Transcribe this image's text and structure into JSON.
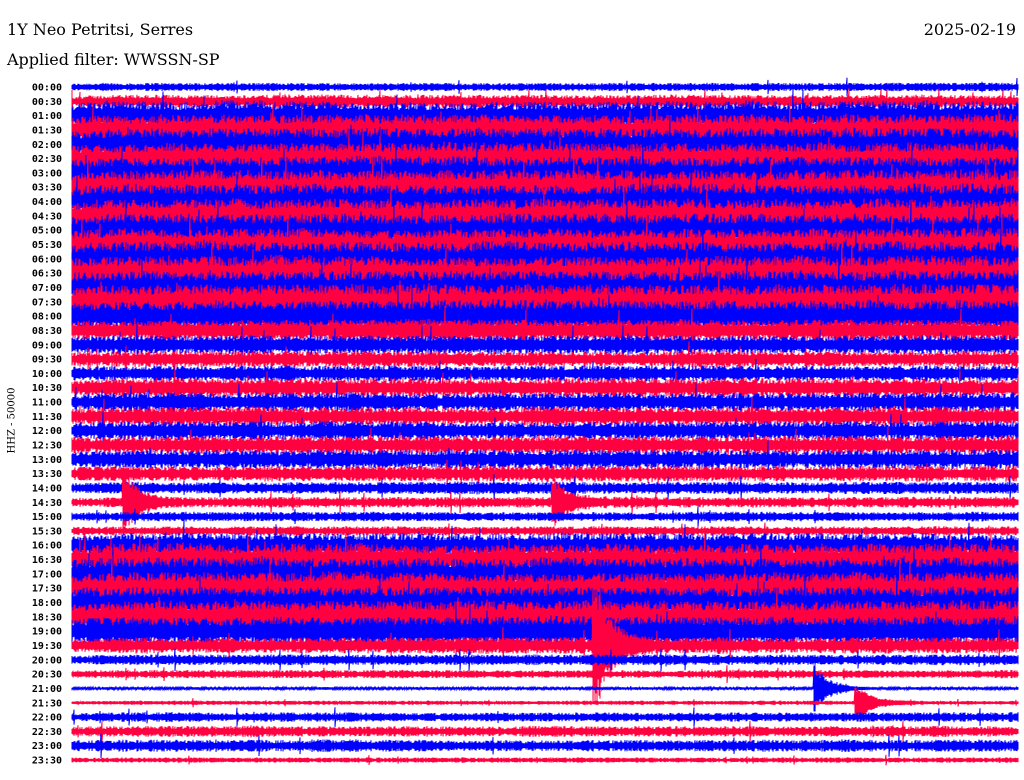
{
  "header": {
    "station": "1Y Neo Petritsi, Serres",
    "date": "2025-02-19",
    "filter": "Applied filter: WWSSN-SP"
  },
  "chart_data": {
    "type": "line",
    "title": "1Y Neo Petritsi, Serres",
    "ylabel": "HHZ - 50000",
    "xlabel": "",
    "colors": [
      "#0000ff",
      "#ff0040"
    ],
    "row_labels": [
      "00:00",
      "00:30",
      "01:00",
      "01:30",
      "02:00",
      "02:30",
      "03:00",
      "03:30",
      "04:00",
      "04:30",
      "05:00",
      "05:30",
      "06:00",
      "06:30",
      "07:00",
      "07:30",
      "08:00",
      "08:30",
      "09:00",
      "09:30",
      "10:00",
      "10:30",
      "11:00",
      "11:30",
      "12:00",
      "12:30",
      "13:00",
      "13:30",
      "14:00",
      "14:30",
      "15:00",
      "15:30",
      "16:00",
      "16:30",
      "17:00",
      "17:30",
      "18:00",
      "18:30",
      "19:00",
      "19:30",
      "20:00",
      "20:30",
      "21:00",
      "21:30",
      "22:00",
      "22:30",
      "23:00",
      "23:30"
    ],
    "relative_noise_amplitude": [
      0.3,
      0.5,
      1.1,
      1.2,
      1.2,
      1.2,
      1.2,
      1.3,
      1.3,
      1.3,
      1.2,
      1.2,
      1.3,
      1.3,
      1.3,
      1.3,
      1.2,
      0.8,
      0.7,
      0.6,
      0.6,
      0.7,
      0.7,
      0.7,
      0.7,
      0.7,
      0.7,
      0.6,
      0.45,
      0.4,
      0.35,
      0.35,
      0.9,
      1.2,
      1.2,
      1.2,
      1.2,
      1.2,
      1.1,
      0.6,
      0.4,
      0.3,
      0.1,
      0.15,
      0.35,
      0.4,
      0.45,
      0.2
    ],
    "events": [
      {
        "row": 39,
        "minute": 16.5,
        "amplitude": 6
      },
      {
        "row": 42,
        "minute": 23.5,
        "amplitude": 2
      },
      {
        "row": 43,
        "minute": 24.8,
        "amplitude": 1.5
      },
      {
        "row": 29,
        "minute": 1.6,
        "amplitude": 2.5
      },
      {
        "row": 29,
        "minute": 15.2,
        "amplitude": 2
      }
    ],
    "minutes_per_row": 30
  }
}
